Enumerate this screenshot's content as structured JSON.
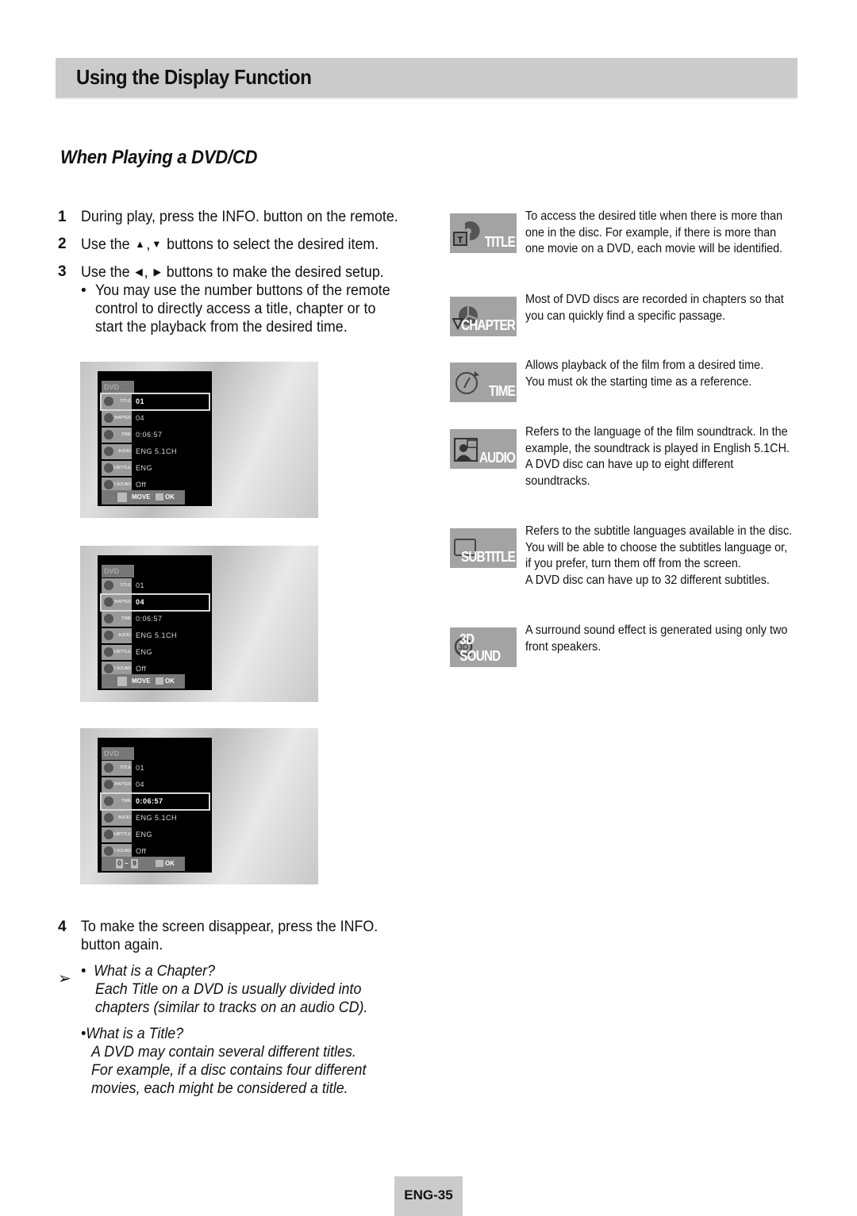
{
  "header": {
    "title": "Using the Display Function"
  },
  "section": {
    "title": "When Playing a DVD/CD"
  },
  "steps": [
    {
      "num": "1",
      "text": "During play, press the INFO. button on the remote."
    },
    {
      "num": "2",
      "pre": "Use the",
      "up": "▲",
      "sep": ",",
      "down": "▼",
      "post": "buttons to select the desired item."
    },
    {
      "num": "3",
      "pre": "Use the",
      "left": "◀",
      "sep": ",",
      "right": "▶",
      "post": "buttons to make the desired setup."
    }
  ],
  "substep": {
    "bullet": "•",
    "text": "You may use the number buttons of the remote control to directly access a title, chapter or to start the playback from the desired time."
  },
  "osd_screens": [
    {
      "header": "DVD",
      "selected": 0,
      "rows": [
        {
          "label": "TITLE",
          "value": "01"
        },
        {
          "label": "CHAPTER",
          "value": "04"
        },
        {
          "label": "TIME",
          "value": "0:06:57"
        },
        {
          "label": "AUDIO",
          "value": "ENG 5.1CH"
        },
        {
          "label": "SUBTITLE",
          "value": "ENG"
        },
        {
          "label": "3D SOUND",
          "value": "Off"
        }
      ],
      "footer": {
        "type": "move",
        "left": "MOVE",
        "right": "OK"
      }
    },
    {
      "header": "DVD",
      "selected": 1,
      "rows": [
        {
          "label": "TITLE",
          "value": "01"
        },
        {
          "label": "CHAPTER",
          "value": "04"
        },
        {
          "label": "TIME",
          "value": "0:06:57"
        },
        {
          "label": "AUDIO",
          "value": "ENG 5.1CH"
        },
        {
          "label": "SUBTITLE",
          "value": "ENG"
        },
        {
          "label": "3D SOUND",
          "value": "Off"
        }
      ],
      "footer": {
        "type": "move",
        "left": "MOVE",
        "right": "OK"
      }
    },
    {
      "header": "DVD",
      "selected": 2,
      "rows": [
        {
          "label": "TITLE",
          "value": "01"
        },
        {
          "label": "CHAPTER",
          "value": "04"
        },
        {
          "label": "TIME",
          "value": "0:06:57"
        },
        {
          "label": "AUDIO",
          "value": "ENG 5.1CH"
        },
        {
          "label": "SUBTITLE",
          "value": "ENG"
        },
        {
          "label": "3D SOUND",
          "value": "Off"
        }
      ],
      "footer": {
        "type": "numeric",
        "num_from": "0",
        "tilde": "~",
        "num_to": "9",
        "right": "OK"
      }
    }
  ],
  "features": [
    {
      "name": "TITLE",
      "icon": "title-disc-icon",
      "lines": [
        "To access the desired title when there is more than",
        "one in the disc. For example, if there is more than",
        "one movie on a DVD, each movie will be identified."
      ]
    },
    {
      "name": "CHAPTER",
      "icon": "chapter-disc-icon",
      "lines": [
        "Most of DVD discs are recorded in chapters so that",
        "you can quickly find a specific passage."
      ]
    },
    {
      "name": "TIME",
      "icon": "clock-icon",
      "lines": [
        "Allows playback of the film from a desired time.",
        "You must ok the starting time as a reference."
      ]
    },
    {
      "name": "AUDIO",
      "icon": "audio-speaker-icon",
      "lines": [
        "Refers to the language of the film soundtrack. In the",
        "example, the soundtrack is played in English 5.1CH.",
        "A DVD disc can have up to eight different",
        "soundtracks."
      ]
    },
    {
      "name": "SUBTITLE",
      "icon": "subtitle-screen-icon",
      "lines": [
        "Refers to the subtitle languages available in the disc.",
        "You will be able to choose the subtitles language or,",
        "if you prefer, turn them off from the screen.",
        "A DVD disc can have up to 32 different subtitles."
      ]
    },
    {
      "name": "3D SOUND",
      "icon": "3d-sound-icon",
      "lines": [
        "A surround sound effect is generated using only two",
        "front speakers."
      ]
    }
  ],
  "step4": {
    "num": "4",
    "lines": [
      "To make the screen disappear, press the INFO.",
      "button again."
    ]
  },
  "notes": {
    "arrow": "➢",
    "bullet": "•",
    "chapter": {
      "q": "What is a Chapter?",
      "lines": [
        "Each Title on a DVD is usually divided into",
        "chapters (similar to  tracks on an audio CD)."
      ]
    },
    "title": {
      "q": "What is a Title?",
      "lines": [
        "A DVD may contain several different titles.",
        "For example, if a disc contains four different",
        "movies, each might be considered a title."
      ]
    }
  },
  "footer": {
    "page": "ENG-35"
  }
}
